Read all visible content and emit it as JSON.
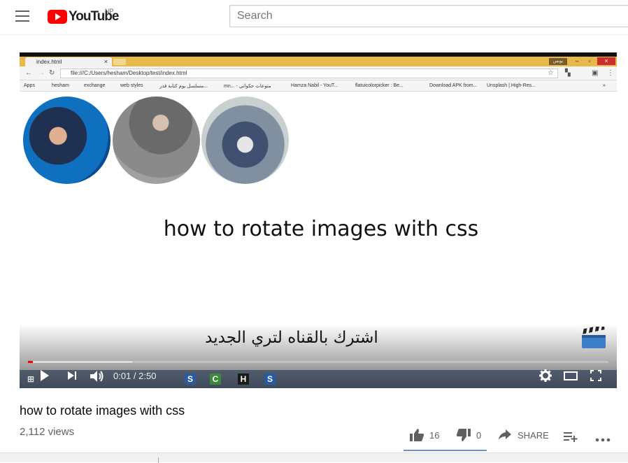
{
  "masthead": {
    "logo_text": "YouTube",
    "country_code": "NP",
    "search_placeholder": "Search"
  },
  "player": {
    "browser": {
      "tab_title": "index.html",
      "tab_close": "×",
      "window_label": "يونس",
      "url": "file:///C:/Users/hesham/Desktop/test/index.html",
      "bookmarks": [
        "Apps",
        "hesham",
        "exchange",
        "web styles",
        "مسلسل يوم كتابة قدر...",
        "mn... - متوعات حكواتي",
        "Hamza Nabil - YouT...",
        "flatuicolorpicker : Be...",
        "Download APK from...",
        "Unsplash | High-Res..."
      ],
      "bookmarks_more": "»"
    },
    "overlay_title": "how to rotate images with css",
    "overlay_arabic": "اشترك بالقناه لتري الجديد",
    "progress": {
      "played": 0.008,
      "loaded": 0.18
    },
    "time": "0:01 / 2:50",
    "taskbar_icons": [
      "S",
      "C",
      "H",
      "S"
    ]
  },
  "video": {
    "title": "how to rotate images with css",
    "views": "2,112 views",
    "likes": "16",
    "dislikes": "0",
    "share_label": "SHARE",
    "like_ratio": 1.0
  },
  "colors": {
    "brand_red": "#ff0000",
    "progress_red": "#ff0000",
    "text_primary": "#0a0a0a",
    "text_secondary": "#606060"
  }
}
